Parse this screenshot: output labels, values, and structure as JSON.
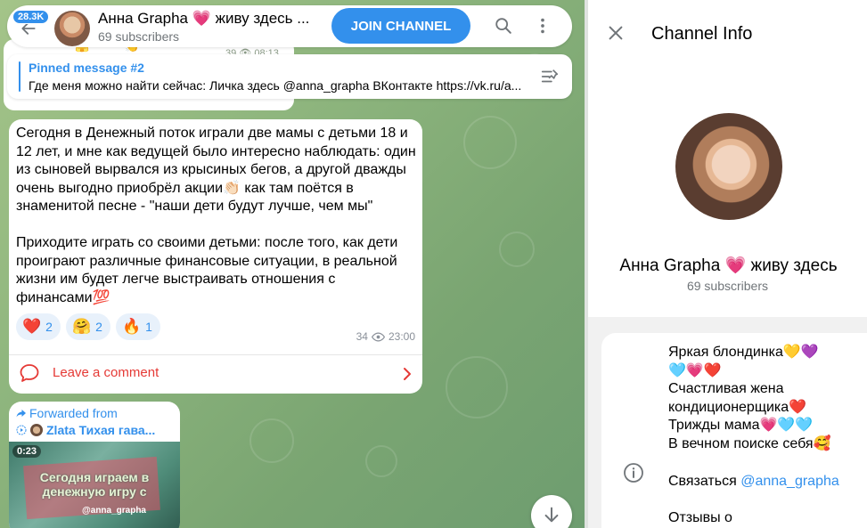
{
  "header": {
    "unread_count": "28.3K",
    "channel_title": "Анна Grapha 💗 живу здесь ...",
    "subscribers": "69 subscribers",
    "join_label": "JOIN CHANNEL"
  },
  "previous_message": {
    "views": "39",
    "time": "08:13"
  },
  "pinned": {
    "label": "Pinned message #2",
    "text": "Где меня можно найти сейчас: Личка здесь @anna_grapha ВКонтакте https://vk.ru/a..."
  },
  "message": {
    "text": "Сегодня в Денежный поток играли две мамы с детьми 18 и 12 лет, и мне как ведущей было интересно наблюдать: один из сыновей вырвался из крысиных бегов, а другой дважды очень выгодно приобрёл акции👏🏻 как там поётся в знаменитой песне - \"наши дети будут лучше, чем мы\"\n\nПриходите играть со своими детьми: после того, как дети проиграют различные финансовые ситуации, в реальной жизни им будет легче выстраивать отношения с финансами💯",
    "reactions": [
      {
        "emoji": "❤️",
        "count": "2"
      },
      {
        "emoji": "🤗",
        "count": "2"
      },
      {
        "emoji": "🔥",
        "count": "1"
      }
    ],
    "views": "34",
    "time": "23:00",
    "comment_label": "Leave a comment"
  },
  "forwarded": {
    "label": "Forwarded from",
    "source": "Zlata Тихая гава...",
    "video_duration": "0:23",
    "video_caption": "Сегодня играем в денежную игру с",
    "video_watermark": "@anna_grapha"
  },
  "info_panel": {
    "title": "Channel Info",
    "name": "Анна Grapha 💗 живу здесь",
    "subscribers": "69 subscribers",
    "about": "Яркая блондинка💛💜\n🩵💗❤️\nСчастливая жена кондиционерщика❤️\nТрижды мама💗🩵🩵\nВ вечном поиске себя🥰",
    "contact_prefix": "Связаться ",
    "contact_link": "@anna_grapha",
    "reviews": "Отзывы о"
  },
  "colors": {
    "accent": "#3390ec",
    "comment_red": "#e53935",
    "chat_bg": "#8fb67e"
  }
}
